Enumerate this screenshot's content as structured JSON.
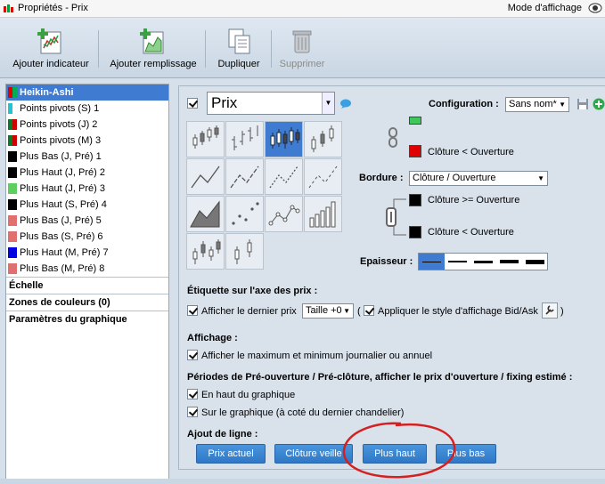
{
  "window": {
    "title": "Propriétés - Prix",
    "mode_label": "Mode d'affichage"
  },
  "toolbar": {
    "add_indicator": "Ajouter indicateur",
    "add_fill": "Ajouter remplissage",
    "duplicate": "Dupliquer",
    "delete": "Supprimer"
  },
  "sidebar": {
    "items": [
      {
        "label": "Heikin-Ashi",
        "colors": [
          "#e00000",
          "#00b050"
        ]
      },
      {
        "label": "Points pivots (S) 1",
        "colors": [
          "#22c4d0",
          "#ffffff"
        ]
      },
      {
        "label": "Points pivots (J) 2",
        "colors": [
          "#0a7a2a",
          "#d00000"
        ]
      },
      {
        "label": "Points pivots (M) 3",
        "colors": [
          "#0a7a2a",
          "#d00000"
        ]
      },
      {
        "label": "Plus Bas (J, Pré) 1",
        "colors": [
          "#000000"
        ]
      },
      {
        "label": "Plus Haut (J, Pré) 2",
        "colors": [
          "#000000"
        ]
      },
      {
        "label": "Plus Haut (J, Pré) 3",
        "colors": [
          "#5ecf5e"
        ]
      },
      {
        "label": "Plus Haut (S, Pré) 4",
        "colors": [
          "#000000"
        ]
      },
      {
        "label": "Plus Bas (J, Pré) 5",
        "colors": [
          "#e07070"
        ]
      },
      {
        "label": "Plus Bas (S, Pré) 6",
        "colors": [
          "#e07070"
        ]
      },
      {
        "label": "Plus Haut (M, Pré) 7",
        "colors": [
          "#0000e0"
        ]
      },
      {
        "label": "Plus Bas (M, Pré) 8",
        "colors": [
          "#e07070"
        ]
      }
    ],
    "sections": [
      "Échelle",
      "Zones de couleurs (0)",
      "Paramètres du graphique"
    ]
  },
  "panel": {
    "series_name": "Prix",
    "configuration_label": "Configuration :",
    "configuration_value": "Sans nom*",
    "cloture_inf": "Clôture < Ouverture",
    "bordure_label": "Bordure :",
    "bordure_value": "Clôture / Ouverture",
    "cloture_sup_eq": "Clôture >= Ouverture",
    "cloture_inf2": "Clôture < Ouverture",
    "epaisseur_label": "Epaisseur :",
    "etiquette_title": "Étiquette sur l'axe des prix :",
    "afficher_dernier": "Afficher le dernier prix",
    "taille_value": "Taille +0",
    "paren_open": "(",
    "appliquer_style": "Appliquer le style d'affichage Bid/Ask",
    "paren_close": ")",
    "affichage_title": "Affichage :",
    "afficher_max_min": "Afficher le maximum et minimum journalier ou annuel",
    "periodes_title": "Périodes de Pré-ouverture / Pré-clôture, afficher le prix d'ouverture / fixing estimé :",
    "en_haut": "En haut du graphique",
    "sur_graphique": "Sur le graphique (à coté du dernier chandelier)",
    "ajout_title": "Ajout de ligne :",
    "buttons": [
      "Prix actuel",
      "Clôture veille",
      "Plus haut",
      "Plus bas"
    ]
  },
  "colors": {
    "selection": "#3f7bd1",
    "red_swatch": "#e00000",
    "green_swatch": "#3cc85a",
    "black_swatch": "#000000",
    "annotation": "#d42020"
  }
}
